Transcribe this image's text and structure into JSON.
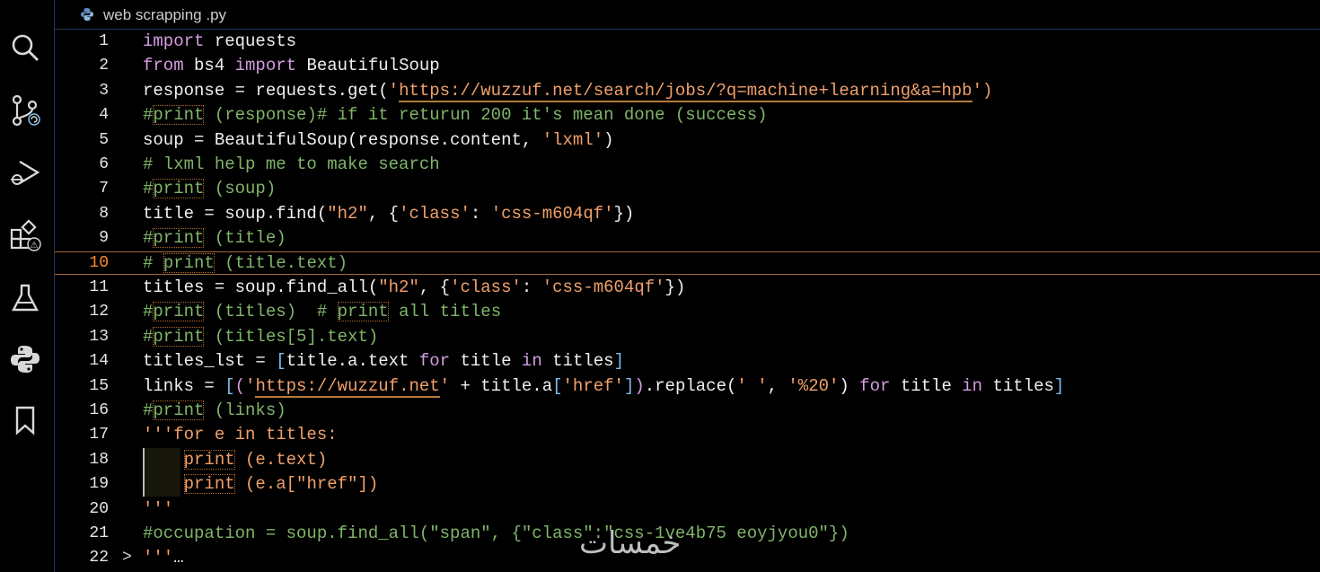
{
  "tab": {
    "title": "web scrapping .py",
    "icon": "python-file-icon"
  },
  "activity_bar": [
    "search-icon",
    "source-control-icon",
    "run-debug-icon",
    "extensions-icon",
    "testing-icon",
    "python-icon",
    "bookmark-icon"
  ],
  "current_line": 10,
  "lines": [
    {
      "n": "1",
      "tokens": [
        {
          "t": "import",
          "c": "kw"
        },
        {
          "t": " requests",
          "c": "df"
        }
      ]
    },
    {
      "n": "2",
      "tokens": [
        {
          "t": "from",
          "c": "kw"
        },
        {
          "t": " bs4 ",
          "c": "df"
        },
        {
          "t": "import",
          "c": "kw"
        },
        {
          "t": " BeautifulSoup",
          "c": "df"
        }
      ]
    },
    {
      "n": "3",
      "tokens": [
        {
          "t": "response = requests.get(",
          "c": "df"
        },
        {
          "t": "'",
          "c": "st"
        },
        {
          "t": "https://wuzzuf.net/search/jobs/?q=machine+learning&a=hpb",
          "c": "st",
          "u": 1
        },
        {
          "t": "')",
          "c": "st"
        }
      ]
    },
    {
      "n": "4",
      "tokens": [
        {
          "t": "#",
          "c": "cm"
        },
        {
          "t": "print",
          "c": "cm",
          "b": 1
        },
        {
          "t": " (response)# if it returun 200 it's mean done (success)",
          "c": "cm"
        }
      ]
    },
    {
      "n": "5",
      "tokens": [
        {
          "t": "soup = BeautifulSoup(response.content, ",
          "c": "df"
        },
        {
          "t": "'lxml'",
          "c": "st"
        },
        {
          "t": ")",
          "c": "df"
        }
      ]
    },
    {
      "n": "6",
      "tokens": [
        {
          "t": "# lxml help me to make search",
          "c": "cm"
        }
      ]
    },
    {
      "n": "7",
      "tokens": [
        {
          "t": "#",
          "c": "cm"
        },
        {
          "t": "print",
          "c": "cm",
          "b": 1
        },
        {
          "t": " (soup)",
          "c": "cm"
        }
      ]
    },
    {
      "n": "8",
      "tokens": [
        {
          "t": "title = soup.find(",
          "c": "df"
        },
        {
          "t": "\"h2\"",
          "c": "st"
        },
        {
          "t": ", {",
          "c": "df"
        },
        {
          "t": "'class'",
          "c": "st"
        },
        {
          "t": ": ",
          "c": "df"
        },
        {
          "t": "'css-m604qf'",
          "c": "st"
        },
        {
          "t": "})",
          "c": "df"
        }
      ]
    },
    {
      "n": "9",
      "tokens": [
        {
          "t": "#",
          "c": "cm"
        },
        {
          "t": "print",
          "c": "cm",
          "b": 1
        },
        {
          "t": " (title)",
          "c": "cm"
        }
      ]
    },
    {
      "n": "10",
      "tokens": [
        {
          "t": "# ",
          "c": "cm"
        },
        {
          "t": "print",
          "c": "cm",
          "b": 1
        },
        {
          "t": " (title.text)",
          "c": "cm"
        }
      ]
    },
    {
      "n": "11",
      "tokens": [
        {
          "t": "titles = soup.find_all(",
          "c": "df"
        },
        {
          "t": "\"h2\"",
          "c": "st"
        },
        {
          "t": ", {",
          "c": "df"
        },
        {
          "t": "'class'",
          "c": "st"
        },
        {
          "t": ": ",
          "c": "df"
        },
        {
          "t": "'css-m604qf'",
          "c": "st"
        },
        {
          "t": "})",
          "c": "df"
        }
      ]
    },
    {
      "n": "12",
      "tokens": [
        {
          "t": "#",
          "c": "cm"
        },
        {
          "t": "print",
          "c": "cm",
          "b": 1
        },
        {
          "t": " (titles)  # ",
          "c": "cm"
        },
        {
          "t": "print",
          "c": "cm",
          "b": 1
        },
        {
          "t": " all titles",
          "c": "cm"
        }
      ]
    },
    {
      "n": "13",
      "tokens": [
        {
          "t": "#",
          "c": "cm"
        },
        {
          "t": "print",
          "c": "cm",
          "b": 1
        },
        {
          "t": " (titles[5].text)",
          "c": "cm"
        }
      ]
    },
    {
      "n": "14",
      "tokens": [
        {
          "t": "titles_lst = ",
          "c": "df"
        },
        {
          "t": "[",
          "c": "bl"
        },
        {
          "t": "title.a.text ",
          "c": "df"
        },
        {
          "t": "for",
          "c": "kw"
        },
        {
          "t": " title ",
          "c": "df"
        },
        {
          "t": "in",
          "c": "kw"
        },
        {
          "t": " titles",
          "c": "df"
        },
        {
          "t": "]",
          "c": "bl"
        }
      ]
    },
    {
      "n": "15",
      "tokens": [
        {
          "t": "links = ",
          "c": "df"
        },
        {
          "t": "[",
          "c": "bl"
        },
        {
          "t": "(",
          "c": "kw"
        },
        {
          "t": "'",
          "c": "st"
        },
        {
          "t": "https://wuzzuf.net",
          "c": "st",
          "u": 1
        },
        {
          "t": "'",
          "c": "st"
        },
        {
          "t": " + title.a",
          "c": "df"
        },
        {
          "t": "[",
          "c": "bl"
        },
        {
          "t": "'href'",
          "c": "st"
        },
        {
          "t": "]",
          "c": "bl"
        },
        {
          "t": ")",
          "c": "kw"
        },
        {
          "t": ".replace(",
          "c": "df"
        },
        {
          "t": "' '",
          "c": "st"
        },
        {
          "t": ", ",
          "c": "df"
        },
        {
          "t": "'%20'",
          "c": "st"
        },
        {
          "t": ") ",
          "c": "df"
        },
        {
          "t": "for",
          "c": "kw"
        },
        {
          "t": " title ",
          "c": "df"
        },
        {
          "t": "in",
          "c": "kw"
        },
        {
          "t": " titles",
          "c": "df"
        },
        {
          "t": "]",
          "c": "bl"
        }
      ]
    },
    {
      "n": "16",
      "tokens": [
        {
          "t": "#",
          "c": "cm"
        },
        {
          "t": "print",
          "c": "cm",
          "b": 1
        },
        {
          "t": " (links)",
          "c": "cm"
        }
      ]
    },
    {
      "n": "17",
      "tokens": [
        {
          "t": "'''for e in titles:",
          "c": "st"
        }
      ]
    },
    {
      "n": "18",
      "indent": true,
      "tokens": [
        {
          "t": "    ",
          "c": "df"
        },
        {
          "t": "print",
          "c": "st",
          "b": 1
        },
        {
          "t": " (e.text)",
          "c": "st"
        }
      ]
    },
    {
      "n": "19",
      "indent": true,
      "tokens": [
        {
          "t": "    ",
          "c": "df"
        },
        {
          "t": "print",
          "c": "st",
          "b": 1
        },
        {
          "t": " (e.a[\"href\"])",
          "c": "st"
        }
      ]
    },
    {
      "n": "20",
      "tokens": [
        {
          "t": "'''",
          "c": "st"
        }
      ]
    },
    {
      "n": "21",
      "tokens": [
        {
          "t": "#occupation = soup.find_all(\"span\", {\"class\":\"css-1ve4b75 eoyjyou0\"})",
          "c": "cm"
        }
      ]
    },
    {
      "n": "22",
      "fold": ">",
      "tokens": [
        {
          "t": "'''",
          "c": "st"
        },
        {
          "t": "…",
          "c": "df"
        }
      ]
    }
  ],
  "watermark": "خمسات"
}
